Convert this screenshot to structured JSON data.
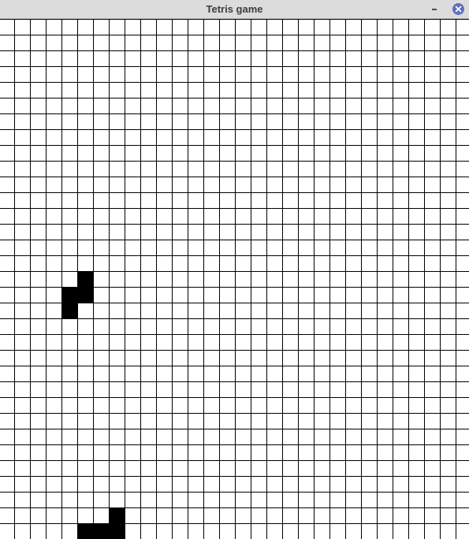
{
  "window": {
    "title": "Tetris game"
  },
  "icons": {
    "minimize": "minimize-icon",
    "close": "close-icon"
  },
  "colors": {
    "titlebar_bg": "#dcdcdc",
    "title_text": "#3c3c3c",
    "close_button": "#5f6fc0",
    "grid_line": "#000000",
    "block": "#000000",
    "board_bg": "#ffffff"
  },
  "game": {
    "columns": 30,
    "rows": 33,
    "pieces": [
      {
        "name": "falling-piece",
        "cells": [
          [
            5,
            16
          ],
          [
            4,
            17
          ],
          [
            5,
            17
          ],
          [
            4,
            18
          ]
        ]
      },
      {
        "name": "landed-piece",
        "cells": [
          [
            7,
            31
          ],
          [
            5,
            32
          ],
          [
            6,
            32
          ],
          [
            7,
            32
          ]
        ]
      }
    ]
  }
}
